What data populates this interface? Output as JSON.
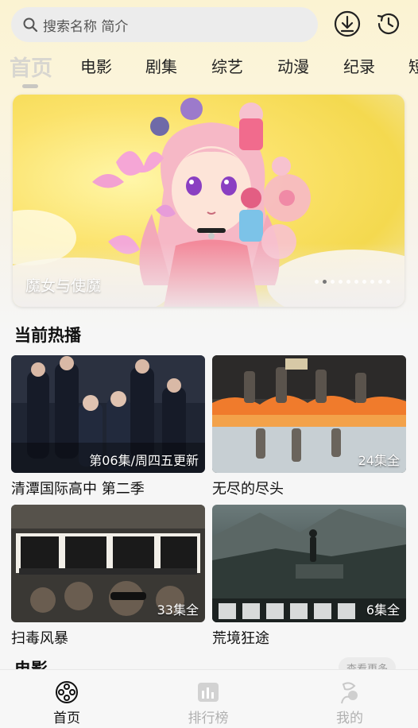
{
  "search": {
    "placeholder": "搜索名称 简介"
  },
  "header_icons": [
    "download-icon",
    "history-icon"
  ],
  "tabs": [
    {
      "label": "首页",
      "active": true
    },
    {
      "label": "电影"
    },
    {
      "label": "剧集"
    },
    {
      "label": "综艺"
    },
    {
      "label": "动漫"
    },
    {
      "label": "纪录"
    },
    {
      "label": "短"
    }
  ],
  "banner": {
    "title": "魔女与使魔",
    "dot_count": 10,
    "active_dot": 1
  },
  "hot": {
    "title": "当前热播",
    "items": [
      {
        "title": "清潭国际高中 第二季",
        "badge": "第06集/周四五更新"
      },
      {
        "title": "无尽的尽头",
        "badge": "24集全"
      },
      {
        "title": "扫毒风暴",
        "badge": "33集全"
      },
      {
        "title": "荒境狂途",
        "badge": "6集全"
      }
    ]
  },
  "next_section": {
    "title": "电影",
    "more": "查看更多"
  },
  "bottom_nav": [
    {
      "label": "首页",
      "icon": "film-reel-icon",
      "active": true
    },
    {
      "label": "排行榜",
      "icon": "ranking-icon",
      "active": false
    },
    {
      "label": "我的",
      "icon": "profile-icon",
      "active": false
    }
  ],
  "colors": {
    "accent_text": "#111111",
    "inactive_text": "#b0b0b0",
    "banner_yellow": "#f4d94f"
  }
}
